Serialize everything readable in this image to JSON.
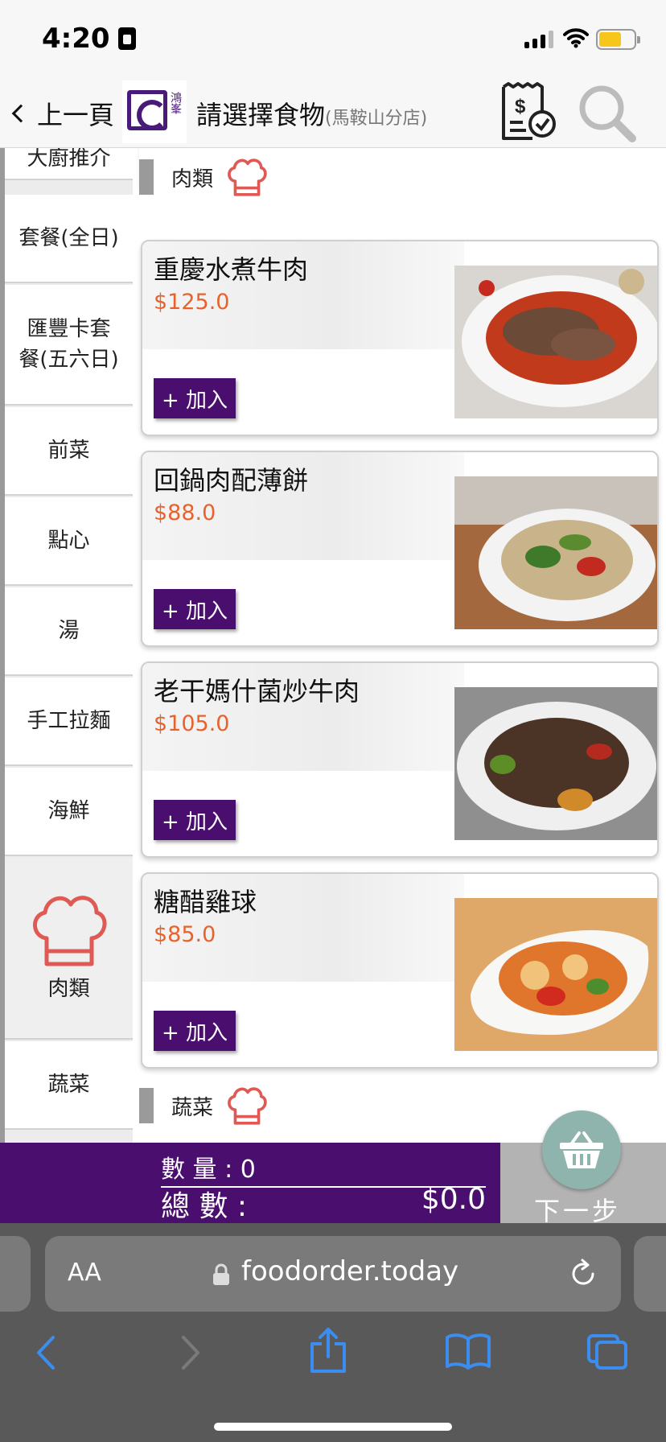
{
  "status": {
    "time": "4:20"
  },
  "header": {
    "back_label": "上一頁",
    "logo_text": "鴻峯",
    "title": "請選擇食物",
    "subtitle": "(馬鞍山分店)"
  },
  "sidebar": {
    "items": [
      {
        "label": "大廚推介"
      },
      {
        "label": "套餐(全日)"
      },
      {
        "label": "匯豐卡套\n餐(五六日)"
      },
      {
        "label": "前菜"
      },
      {
        "label": "點心"
      },
      {
        "label": "湯"
      },
      {
        "label": "手工拉麵"
      },
      {
        "label": "海鮮"
      },
      {
        "label": "肉類"
      },
      {
        "label": "蔬菜"
      }
    ],
    "active": "肉類"
  },
  "main": {
    "top_category": "肉類",
    "bottom_category": "蔬菜",
    "add_label": "+ 加入",
    "dishes": [
      {
        "name": "重慶水煮牛肉",
        "price": "$125.0"
      },
      {
        "name": "回鍋肉配薄餅",
        "price": "$88.0"
      },
      {
        "name": "老干媽什菌炒牛肉",
        "price": "$105.0"
      },
      {
        "name": "糖醋雞球",
        "price": "$85.0"
      }
    ]
  },
  "totals": {
    "qty_label": "數 量 :  0",
    "total_label": "總 數 :",
    "total_value": "$0.0",
    "next_label": "下一步"
  },
  "browser": {
    "aa_label": "AA",
    "url": "foodorder.today"
  },
  "colors": {
    "brand_purple": "#4a0e6e",
    "price_orange": "#e8622c",
    "chef_red": "#e05a55"
  }
}
